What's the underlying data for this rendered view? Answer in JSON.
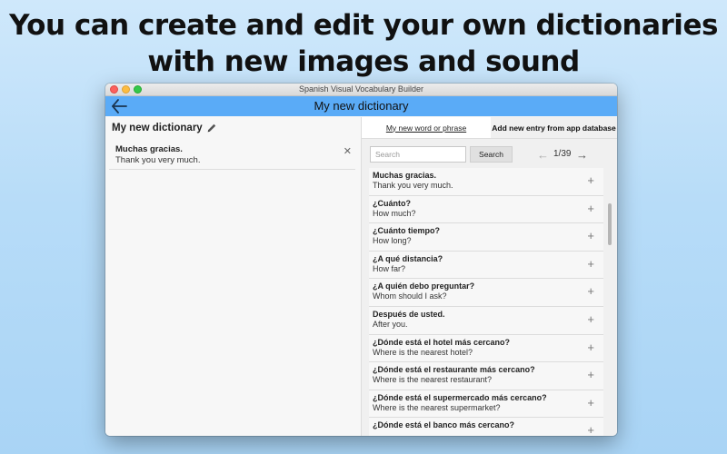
{
  "promo": {
    "line1": "You can create and edit your own dictionaries",
    "line2": "with new images and sound"
  },
  "window": {
    "title": "Spanish Visual Vocabulary Builder"
  },
  "navbar": {
    "title": "My new dictionary",
    "back_icon": "arrow-left-icon"
  },
  "left_panel": {
    "dictionary_title": "My new dictionary",
    "entries": [
      {
        "spanish": "Muchas gracias.",
        "english": "Thank you very much."
      }
    ]
  },
  "tabs": {
    "my_word": "My new word or phrase",
    "from_database": "Add new entry from app database"
  },
  "search": {
    "placeholder": "Search",
    "button_label": "Search"
  },
  "pagination": {
    "indicator": "1/39"
  },
  "database_items": [
    {
      "spanish": "Muchas gracias.",
      "english": "Thank you very much."
    },
    {
      "spanish": "¿Cuánto?",
      "english": "How much?"
    },
    {
      "spanish": "¿Cuánto tiempo?",
      "english": "How long?"
    },
    {
      "spanish": "¿A qué distancia?",
      "english": "How far?"
    },
    {
      "spanish": "¿A quién debo preguntar?",
      "english": "Whom should I ask?"
    },
    {
      "spanish": "Después de usted.",
      "english": "After you."
    },
    {
      "spanish": "¿Dónde está el hotel más cercano?",
      "english": "Where is the nearest hotel?"
    },
    {
      "spanish": "¿Dónde está el restaurante más cercano?",
      "english": "Where is the nearest restaurant?"
    },
    {
      "spanish": "¿Dónde está el supermercado más cercano?",
      "english": "Where is the nearest supermarket?"
    },
    {
      "spanish": "¿Dónde está el banco más cercano?",
      "english": ""
    }
  ],
  "colors": {
    "navbar": "#5aabf7",
    "background": "#b7dcf8"
  }
}
